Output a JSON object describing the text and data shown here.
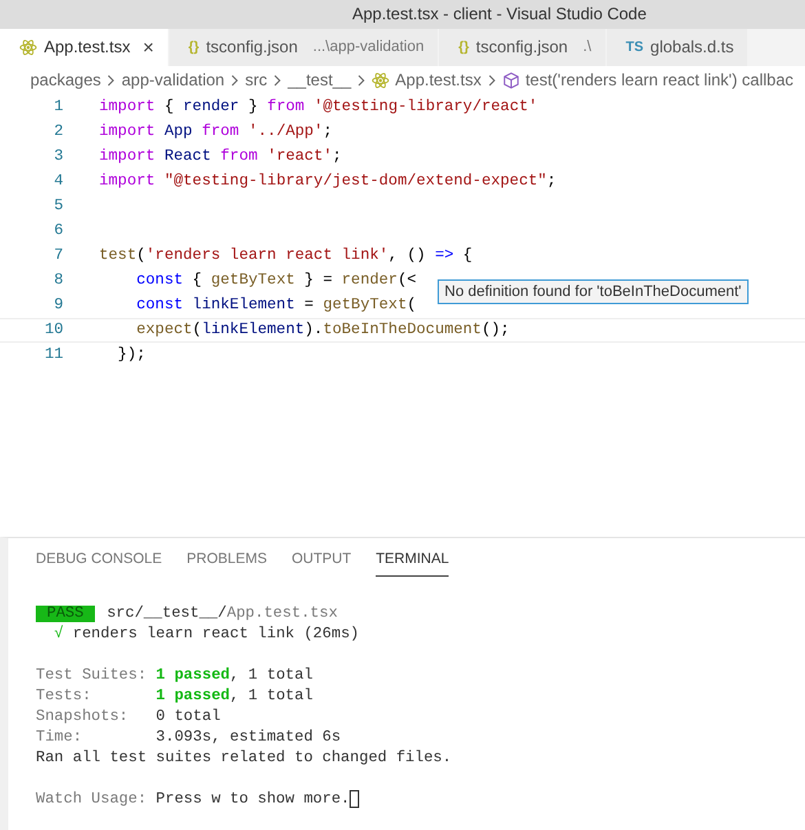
{
  "window": {
    "title": "App.test.tsx - client - Visual Studio Code"
  },
  "tabs": [
    {
      "label": "App.test.tsx",
      "selected": true,
      "icon": {
        "kind": "react"
      },
      "close": "×"
    },
    {
      "label": "tsconfig.json",
      "detail": "...\\app-validation",
      "selected": false,
      "icon": {
        "kind": "json",
        "text": "{}"
      }
    },
    {
      "label": "tsconfig.json",
      "detail": ".\\",
      "selected": false,
      "icon": {
        "kind": "json",
        "text": "{}"
      }
    },
    {
      "label": "globals.d.ts",
      "selected": false,
      "icon": {
        "kind": "ts",
        "text": "TS"
      }
    }
  ],
  "breadcrumb": [
    {
      "label": "packages",
      "kind": "folder"
    },
    {
      "label": "app-validation",
      "kind": "folder"
    },
    {
      "label": "src",
      "kind": "folder"
    },
    {
      "label": "__test__",
      "kind": "folder"
    },
    {
      "label": "App.test.tsx",
      "kind": "react"
    },
    {
      "label": "test('renders learn react link') callbac",
      "kind": "symbol"
    }
  ],
  "editor": {
    "lines": [
      {
        "num": "1",
        "current": false,
        "tokens": [
          {
            "t": "import ",
            "kind": "keyword"
          },
          {
            "t": "{ ",
            "kind": "punct"
          },
          {
            "t": "render",
            "kind": "variable"
          },
          {
            "t": " } ",
            "kind": "punct"
          },
          {
            "t": "from ",
            "kind": "keyword"
          },
          {
            "t": "'@testing-library/react'",
            "kind": "string"
          }
        ]
      },
      {
        "num": "2",
        "current": false,
        "tokens": [
          {
            "t": "import ",
            "kind": "keyword"
          },
          {
            "t": "App ",
            "kind": "variable"
          },
          {
            "t": "from ",
            "kind": "keyword"
          },
          {
            "t": "'../App'",
            "kind": "string"
          },
          {
            "t": ";",
            "kind": "punct"
          }
        ]
      },
      {
        "num": "3",
        "current": false,
        "tokens": [
          {
            "t": "import ",
            "kind": "keyword"
          },
          {
            "t": "React ",
            "kind": "variable"
          },
          {
            "t": "from ",
            "kind": "keyword"
          },
          {
            "t": "'react'",
            "kind": "string"
          },
          {
            "t": ";",
            "kind": "punct"
          }
        ]
      },
      {
        "num": "4",
        "current": false,
        "tokens": [
          {
            "t": "import ",
            "kind": "keyword"
          },
          {
            "t": "\"@testing-library/jest-dom/extend-expect\"",
            "kind": "string"
          },
          {
            "t": ";",
            "kind": "punct"
          }
        ]
      },
      {
        "num": "5",
        "current": false
      },
      {
        "num": "6",
        "current": false
      },
      {
        "num": "7",
        "current": false,
        "tokens": [
          {
            "t": "test",
            "kind": "function"
          },
          {
            "t": "(",
            "kind": "punct"
          },
          {
            "t": "'renders learn react link'",
            "kind": "string"
          },
          {
            "t": ", () ",
            "kind": "punct"
          },
          {
            "t": "=>",
            "kind": "storage"
          },
          {
            "t": " {",
            "kind": "punct"
          }
        ]
      },
      {
        "num": "8",
        "current": false,
        "tokens": [
          {
            "t": "    const",
            "kind": "storage"
          },
          {
            "t": " { ",
            "kind": "punct"
          },
          {
            "t": "getByText",
            "kind": "function"
          },
          {
            "t": " } = ",
            "kind": "punct"
          },
          {
            "t": "render",
            "kind": "function"
          },
          {
            "t": "(<",
            "kind": "punct"
          }
        ]
      },
      {
        "num": "9",
        "current": false,
        "tokens": [
          {
            "t": "    const ",
            "kind": "storage"
          },
          {
            "t": "linkElement",
            "kind": "variable"
          },
          {
            "t": " = ",
            "kind": "punct"
          },
          {
            "t": "getByText",
            "kind": "function"
          },
          {
            "t": "(",
            "kind": "punct"
          }
        ]
      },
      {
        "num": "10",
        "current": true,
        "tokens": [
          {
            "t": "    expect",
            "kind": "function"
          },
          {
            "t": "(",
            "kind": "punct"
          },
          {
            "t": "linkElement",
            "kind": "variable"
          },
          {
            "t": ").",
            "kind": "punct"
          },
          {
            "t": "toBeInTheDocument",
            "kind": "function"
          },
          {
            "t": "();",
            "kind": "punct"
          }
        ]
      },
      {
        "num": "11",
        "current": false,
        "tokens": [
          {
            "t": "  });",
            "kind": "punct"
          }
        ]
      }
    ],
    "tooltip": "No definition found for 'toBeInTheDocument'"
  },
  "panel": {
    "tabs": [
      {
        "label": "DEBUG CONSOLE",
        "selected": false
      },
      {
        "label": "PROBLEMS",
        "selected": false
      },
      {
        "label": "OUTPUT",
        "selected": false
      },
      {
        "label": "TERMINAL",
        "selected": true
      }
    ],
    "terminal": [
      {
        "lines": [
          {
            "segments": [
              {
                "t": "PASS",
                "kind": "badge"
              },
              {
                "t": " src/__test__/",
                "kind": "text"
              },
              {
                "t": "App.test.tsx",
                "kind": "dim"
              }
            ]
          },
          {
            "segments": [
              {
                "t": "  √",
                "kind": "green"
              },
              {
                "t": " renders learn react link (26ms)",
                "kind": "text"
              }
            ]
          }
        ]
      },
      {
        "lines": [
          {
            "segments": [
              {
                "t": "Test Suites: ",
                "kind": "dim"
              },
              {
                "t": "1 passed",
                "kind": "pass"
              },
              {
                "t": ", 1 total",
                "kind": "text"
              }
            ]
          },
          {
            "segments": [
              {
                "t": "Tests:       ",
                "kind": "dim"
              },
              {
                "t": "1 passed",
                "kind": "pass"
              },
              {
                "t": ", 1 total",
                "kind": "text"
              }
            ]
          },
          {
            "segments": [
              {
                "t": "Snapshots:   ",
                "kind": "dim"
              },
              {
                "t": "0 total",
                "kind": "text"
              }
            ]
          },
          {
            "segments": [
              {
                "t": "Time:        ",
                "kind": "dim"
              },
              {
                "t": "3.093s, estimated 6s",
                "kind": "text"
              }
            ]
          },
          {
            "segments": [
              {
                "t": "Ran all test suites related to changed files.",
                "kind": "text"
              }
            ]
          }
        ]
      },
      {
        "lines": [
          {
            "segments": [
              {
                "t": "Watch Usage: ",
                "kind": "dim"
              },
              {
                "t": "Press w to show more.",
                "kind": "text"
              }
            ]
          }
        ]
      }
    ]
  }
}
